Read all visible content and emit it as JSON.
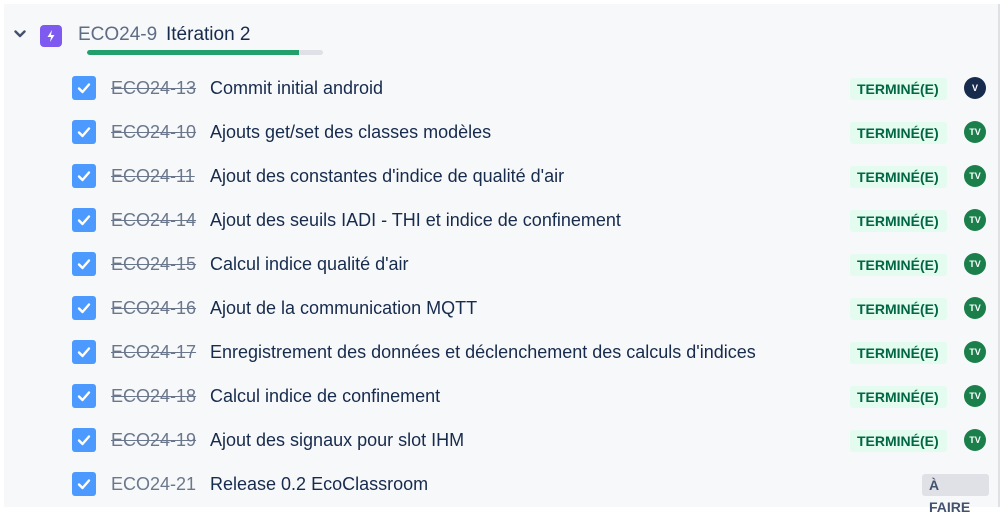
{
  "epic": {
    "key": "ECO24-9",
    "title": "Itération 2",
    "progress": 0.9,
    "icon": "lightning-bolt-icon",
    "color": "#7f5af0"
  },
  "children": [
    {
      "key": "ECO24-13",
      "summary": "Commit initial android",
      "status": "TERMINÉ(E)",
      "done": true,
      "avatar": "V"
    },
    {
      "key": "ECO24-10",
      "summary": "Ajouts get/set des classes modèles",
      "status": "TERMINÉ(E)",
      "done": true,
      "avatar": "TV"
    },
    {
      "key": "ECO24-11",
      "summary": "Ajout des constantes d'indice de qualité d'air",
      "status": "TERMINÉ(E)",
      "done": true,
      "avatar": "TV"
    },
    {
      "key": "ECO24-14",
      "summary": "Ajout des seuils IADI - THI et indice de confinement",
      "status": "TERMINÉ(E)",
      "done": true,
      "avatar": "TV"
    },
    {
      "key": "ECO24-15",
      "summary": "Calcul indice qualité d'air",
      "status": "TERMINÉ(E)",
      "done": true,
      "avatar": "TV"
    },
    {
      "key": "ECO24-16",
      "summary": "Ajout de la communication MQTT",
      "status": "TERMINÉ(E)",
      "done": true,
      "avatar": "TV"
    },
    {
      "key": "ECO24-17",
      "summary": "Enregistrement des données et déclenchement des calculs d'indices",
      "status": "TERMINÉ(E)",
      "done": true,
      "avatar": "TV"
    },
    {
      "key": "ECO24-18",
      "summary": "Calcul indice de confinement",
      "status": "TERMINÉ(E)",
      "done": true,
      "avatar": "TV"
    },
    {
      "key": "ECO24-19",
      "summary": "Ajout des signaux pour slot IHM",
      "status": "TERMINÉ(E)",
      "done": true,
      "avatar": "TV"
    },
    {
      "key": "ECO24-21",
      "summary": "Release 0.2 EcoClassroom",
      "status": "À FAIRE",
      "done": false,
      "avatar": ""
    }
  ]
}
